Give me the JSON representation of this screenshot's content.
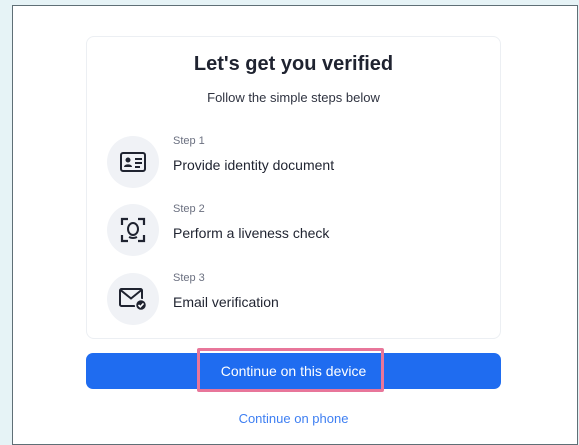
{
  "title": "Let's get you verified",
  "subtitle": "Follow the simple steps below",
  "steps": [
    {
      "step_label": "Step 1",
      "text": "Provide identity document",
      "icon": "id-card-icon"
    },
    {
      "step_label": "Step 2",
      "text": "Perform a liveness check",
      "icon": "face-scan-icon"
    },
    {
      "step_label": "Step 3",
      "text": "Email verification",
      "icon": "envelope-check-icon"
    }
  ],
  "primary_button": "Continue on this device",
  "secondary_link": "Continue on phone",
  "colors": {
    "background": "#e6f3f6",
    "primary": "#1f6cf0",
    "link": "#3e7ff2",
    "highlight": "#e8769a",
    "icon_circle": "#f0f2f6"
  }
}
